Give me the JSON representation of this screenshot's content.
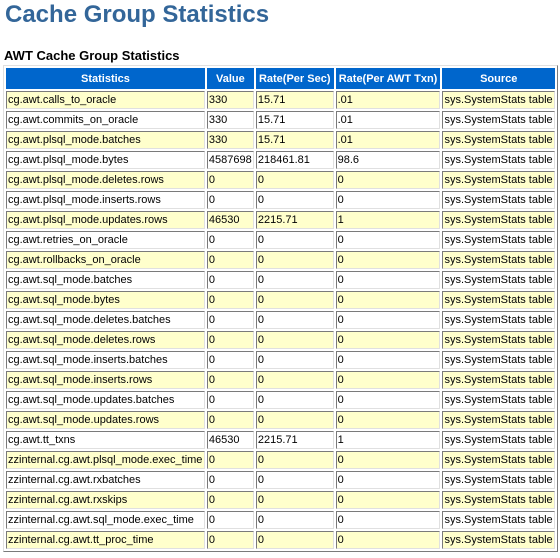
{
  "page": {
    "title": "Cache Group Statistics",
    "section_title": "AWT Cache Group Statistics"
  },
  "table": {
    "headers": [
      "Statistics",
      "Value",
      "Rate(Per Sec)",
      "Rate(Per AWT Txn)",
      "Source"
    ],
    "rows": [
      [
        "cg.awt.calls_to_oracle",
        "330",
        "15.71",
        ".01",
        "sys.SystemStats table"
      ],
      [
        "cg.awt.commits_on_oracle",
        "330",
        "15.71",
        ".01",
        "sys.SystemStats table"
      ],
      [
        "cg.awt.plsql_mode.batches",
        "330",
        "15.71",
        ".01",
        "sys.SystemStats table"
      ],
      [
        "cg.awt.plsql_mode.bytes",
        "4587698",
        "218461.81",
        "98.6",
        "sys.SystemStats table"
      ],
      [
        "cg.awt.plsql_mode.deletes.rows",
        "0",
        "0",
        "0",
        "sys.SystemStats table"
      ],
      [
        "cg.awt.plsql_mode.inserts.rows",
        "0",
        "0",
        "0",
        "sys.SystemStats table"
      ],
      [
        "cg.awt.plsql_mode.updates.rows",
        "46530",
        "2215.71",
        "1",
        "sys.SystemStats table"
      ],
      [
        "cg.awt.retries_on_oracle",
        "0",
        "0",
        "0",
        "sys.SystemStats table"
      ],
      [
        "cg.awt.rollbacks_on_oracle",
        "0",
        "0",
        "0",
        "sys.SystemStats table"
      ],
      [
        "cg.awt.sql_mode.batches",
        "0",
        "0",
        "0",
        "sys.SystemStats table"
      ],
      [
        "cg.awt.sql_mode.bytes",
        "0",
        "0",
        "0",
        "sys.SystemStats table"
      ],
      [
        "cg.awt.sql_mode.deletes.batches",
        "0",
        "0",
        "0",
        "sys.SystemStats table"
      ],
      [
        "cg.awt.sql_mode.deletes.rows",
        "0",
        "0",
        "0",
        "sys.SystemStats table"
      ],
      [
        "cg.awt.sql_mode.inserts.batches",
        "0",
        "0",
        "0",
        "sys.SystemStats table"
      ],
      [
        "cg.awt.sql_mode.inserts.rows",
        "0",
        "0",
        "0",
        "sys.SystemStats table"
      ],
      [
        "cg.awt.sql_mode.updates.batches",
        "0",
        "0",
        "0",
        "sys.SystemStats table"
      ],
      [
        "cg.awt.sql_mode.updates.rows",
        "0",
        "0",
        "0",
        "sys.SystemStats table"
      ],
      [
        "cg.awt.tt_txns",
        "46530",
        "2215.71",
        "1",
        "sys.SystemStats table"
      ],
      [
        "zzinternal.cg.awt.plsql_mode.exec_time",
        "0",
        "0",
        "0",
        "sys.SystemStats table"
      ],
      [
        "zzinternal.cg.awt.rxbatches",
        "0",
        "0",
        "0",
        "sys.SystemStats table"
      ],
      [
        "zzinternal.cg.awt.rxskips",
        "0",
        "0",
        "0",
        "sys.SystemStats table"
      ],
      [
        "zzinternal.cg.awt.sql_mode.exec_time",
        "0",
        "0",
        "0",
        "sys.SystemStats table"
      ],
      [
        "zzinternal.cg.awt.tt_proc_time",
        "0",
        "0",
        "0",
        "sys.SystemStats table"
      ]
    ]
  },
  "colors": {
    "title": "#336699",
    "header_bg": "#0066cc",
    "header_text": "#ffffff",
    "row_alt_bg": "#ffffcc",
    "row_bg": "#ffffff"
  }
}
